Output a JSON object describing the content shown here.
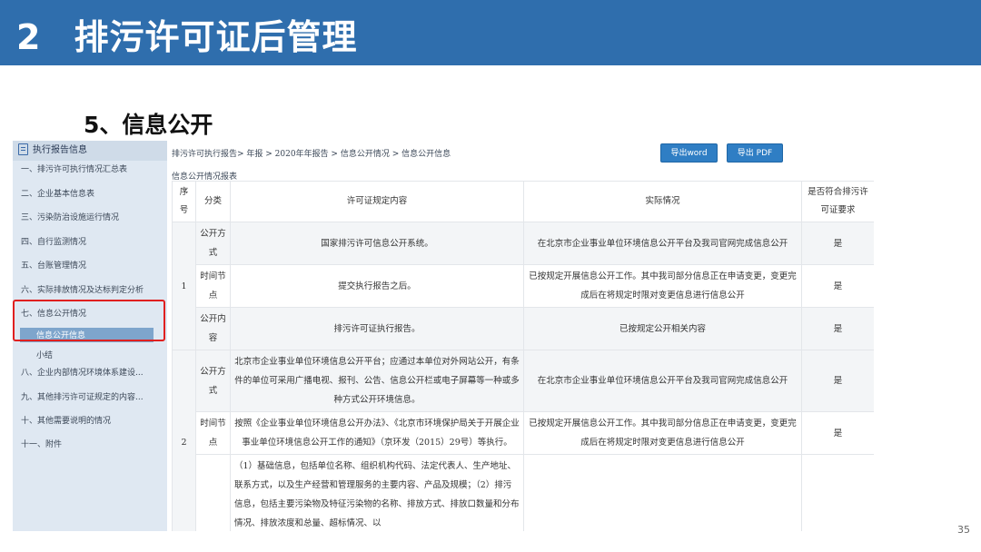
{
  "slide": {
    "number": "2",
    "title": "排污许可证后管理",
    "section_title": "5、信息公开",
    "page_number": "35"
  },
  "sidebar": {
    "header": "执行报告信息",
    "items": [
      "一、排污许可执行情况汇总表",
      "二、企业基本信息表",
      "三、污染防治设施运行情况",
      "四、自行监测情况",
      "五、台账管理情况",
      "六、实际排放情况及达标判定分析",
      "七、信息公开情况",
      "八、企业内部情况环境体系建设...",
      "九、其他排污许可证规定的内容...",
      "十、其他需要说明的情况",
      "十一、附件"
    ],
    "sub_items": [
      "信息公开信息",
      "小结"
    ],
    "selected": "信息公开信息"
  },
  "toolbar": {
    "breadcrumb": "排污许可执行报告> 年报 > 2020年年报告 > 信息公开情况 > 信息公开信息",
    "export_word": "导出word",
    "export_pdf": "导出 PDF"
  },
  "table": {
    "title": "信息公开情况报表",
    "headers": [
      "序号",
      "分类",
      "许可证规定内容",
      "实际情况",
      "是否符合排污许可证要求"
    ],
    "rows": [
      {
        "seq": "1",
        "category": "公开方式",
        "required": "国家排污许可信息公开系统。",
        "actual": "在北京市企业事业单位环境信息公开平台及我司官网完成信息公开",
        "compliant": "是"
      },
      {
        "seq": "",
        "category": "时间节点",
        "required": "提交执行报告之后。",
        "actual": "已按规定开展信息公开工作。其中我司部分信息正在申请变更，变更完成后在将规定时限对变更信息进行信息公开",
        "compliant": "是"
      },
      {
        "seq": "",
        "category": "公开内容",
        "required": "排污许可证执行报告。",
        "actual": "已按规定公开相关内容",
        "compliant": "是"
      },
      {
        "seq": "2",
        "category": "公开方式",
        "required": "北京市企业事业单位环境信息公开平台；应通过本单位对外网站公开，有条件的单位可采用广播电视、报刊、公告、信息公开栏或电子屏幕等一种或多种方式公开环境信息。",
        "actual": "在北京市企业事业单位环境信息公开平台及我司官网完成信息公开",
        "compliant": "是"
      },
      {
        "seq": "",
        "category": "时间节点",
        "required": "按照《企业事业单位环境信息公开办法》、《北京市环境保护局关于开展企业事业单位环境信息公开工作的通知》（京环发（2015）29号）等执行。",
        "actual": "已按规定开展信息公开工作。其中我司部分信息正在申请变更，变更完成后在将规定时限对变更信息进行信息公开",
        "compliant": "是"
      },
      {
        "seq": "",
        "category": "",
        "required": "（1）基础信息，包括单位名称、组织机构代码、法定代表人、生产地址、联系方式，以及生产经营和管理服务的主要内容、产品及规模；（2）排污信息，包括主要污染物及特征污染物的名称、排放方式、排放口数量和分布情况、排放浓度和总量、超标情况、以",
        "actual": "",
        "compliant": ""
      }
    ]
  }
}
